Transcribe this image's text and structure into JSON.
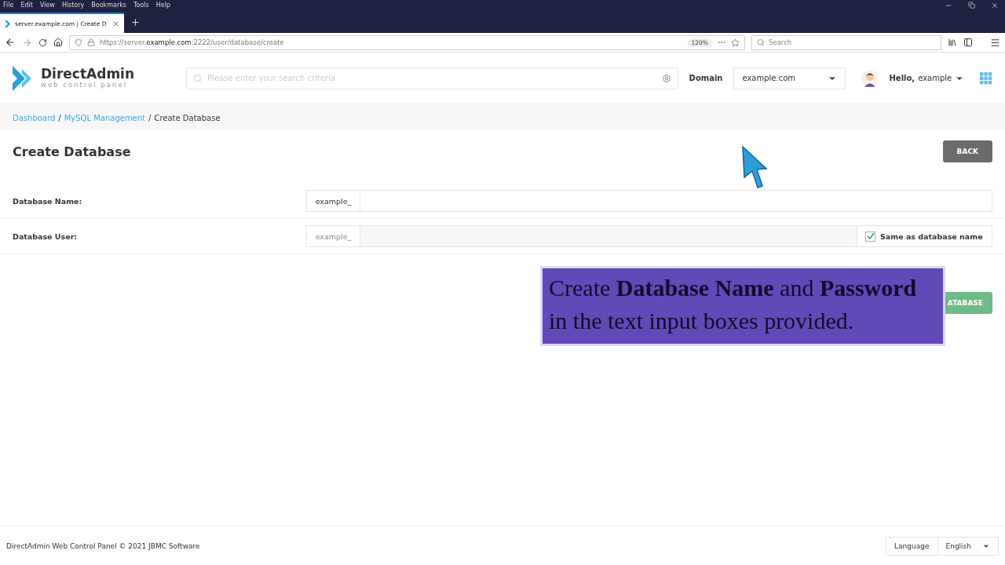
{
  "menu_bar": [
    "File",
    "Edit",
    "View",
    "History",
    "Bookmarks",
    "Tools",
    "Help"
  ],
  "tab": {
    "title": "server.example.com | Create D",
    "selected": true
  },
  "address_bar": {
    "host_prefix": "https://server.",
    "host": "example.com",
    "path": ":2222/user/database/create",
    "zoom": "120%"
  },
  "browser_search": {
    "placeholder": "Search"
  },
  "header": {
    "logo_title": "DirectAdmin",
    "logo_subtitle": "web control panel",
    "search_placeholder": "Please enter your search criteria",
    "domain_label": "Domain",
    "domain_value": "example.com",
    "greeting": "Hello,",
    "user": "example"
  },
  "breadcrumb": [
    {
      "label": "Dashboard",
      "link": true
    },
    {
      "label": "/",
      "link": false
    },
    {
      "label": "MySQL Management",
      "link": true
    },
    {
      "label": "/",
      "link": false
    },
    {
      "label": "Create Database",
      "link": false
    }
  ],
  "page_title": "Create Database",
  "back_button": "BACK",
  "form": [
    {
      "label": "Database Name:",
      "prefix": "example_",
      "disabled": false
    },
    {
      "label": "Database User:",
      "prefix": "example_",
      "disabled": true,
      "checkbox": {
        "label": "Same as database name",
        "checked": true
      }
    }
  ],
  "create_button": "ATABASE",
  "caption": {
    "line_1": "Create **Database Name** and **Password**",
    "line_2": "in the text input boxes provided."
  },
  "footer": {
    "copyright": "DirectAdmin Web Control Panel © 2021 JBMC Software",
    "language_label": "Language",
    "language_value": "English"
  }
}
